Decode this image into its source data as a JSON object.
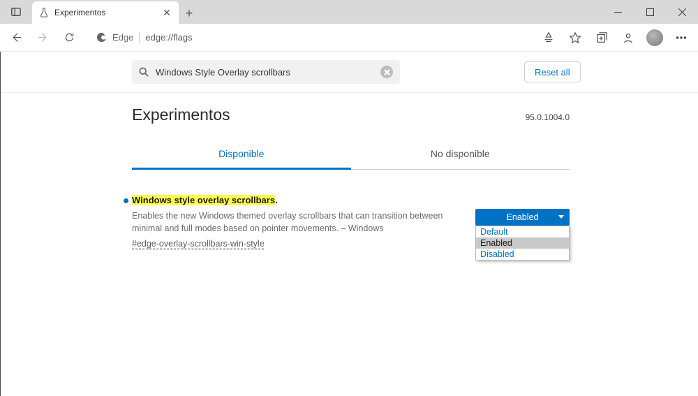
{
  "browser": {
    "tab_title": "Experimentos",
    "address_label": "Edge",
    "url": "edge://flags"
  },
  "header": {
    "search_value": "Windows Style Overlay scrollbars",
    "reset_label": "Reset all"
  },
  "page": {
    "title": "Experimentos",
    "version": "95.0.1004.0",
    "tabs": {
      "available": "Disponible",
      "unavailable": "No disponible"
    }
  },
  "flag": {
    "title_highlight": "Windows style overlay scrollbars",
    "title_suffix": ".",
    "description": "Enables the new Windows themed overlay scrollbars that can transition between minimal and full modes based on pointer movements. – Windows",
    "id": "#edge-overlay-scrollbars-win-style",
    "select": {
      "current": "Enabled",
      "options": {
        "default": "Default",
        "enabled": "Enabled",
        "disabled": "Disabled"
      }
    }
  }
}
